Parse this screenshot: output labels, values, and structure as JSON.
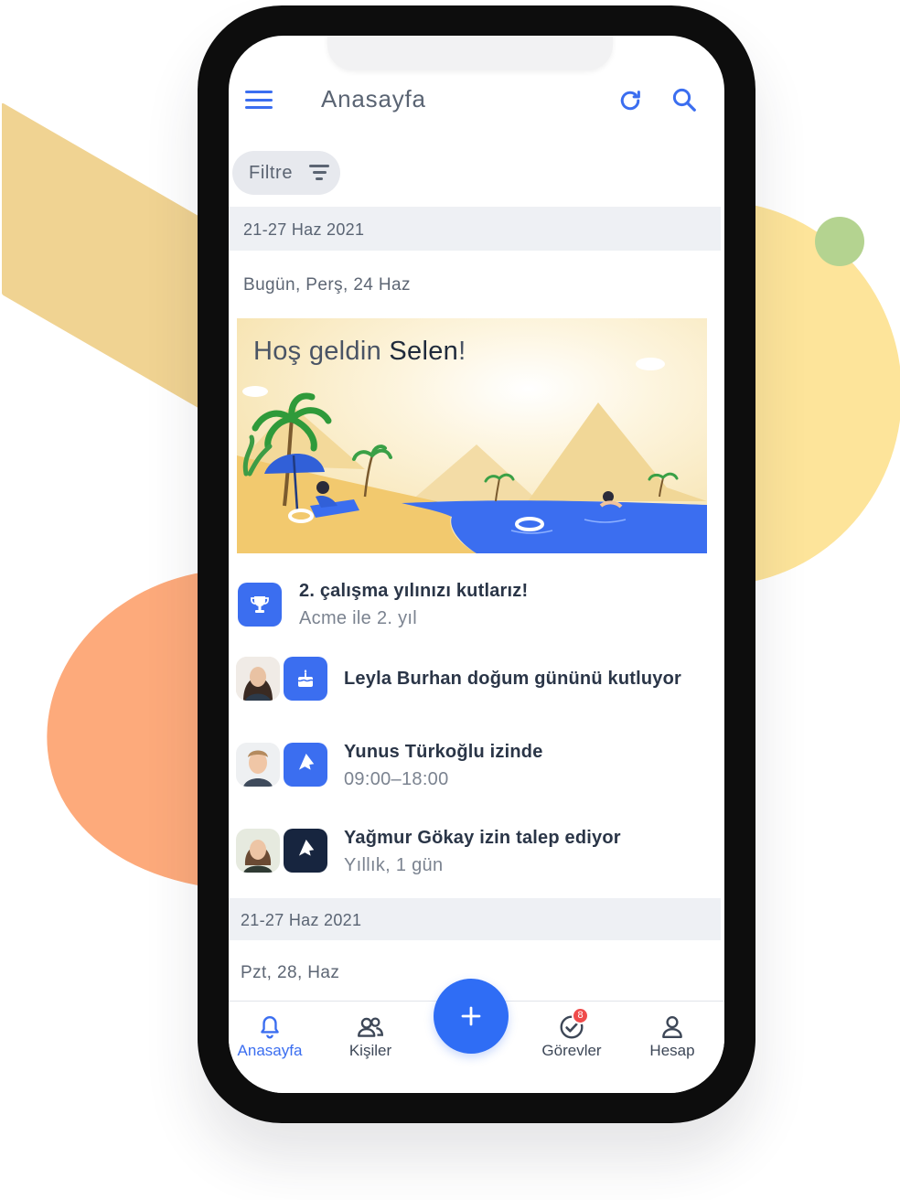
{
  "header": {
    "title": "Anasayfa"
  },
  "filter": {
    "label": "Filtre"
  },
  "feed": {
    "week_range": "21-27 Haz 2021",
    "day_label": "Bugün, Perş, 24 Haz",
    "welcome": {
      "greeting": "Hoş geldin",
      "name": "Selen",
      "punct": "!"
    },
    "anniversary": {
      "title": "2. çalışma yılınızı kutlarız!",
      "subtitle": "Acme ile 2. yıl"
    },
    "events": [
      {
        "title": "Leyla Burhan doğum gününü kutluyor",
        "subtitle": ""
      },
      {
        "title": "Yunus Türkoğlu izinde",
        "subtitle": "09:00–18:00"
      },
      {
        "title": "Yağmur Gökay izin talep ediyor",
        "subtitle": "Yıllık, 1 gün"
      }
    ],
    "week_range_2": "21-27 Haz 2021",
    "day_label_2": "Pzt, 28, Haz"
  },
  "bottom_nav": {
    "items": [
      {
        "label": "Anasayfa",
        "icon": "bell-icon",
        "active": true
      },
      {
        "label": "Kişiler",
        "icon": "people-icon"
      },
      {
        "label": "Görevler",
        "icon": "check-circle-icon",
        "badge": "8"
      },
      {
        "label": "Hesap",
        "icon": "person-icon"
      }
    ],
    "fab_icon": "plus-icon"
  },
  "colors": {
    "accent": "#3b6ef0",
    "dark_icon": "#17253f",
    "badge": "#ef4b4b",
    "deco_yellow": "#fde49a",
    "deco_orange": "#fdaa7b",
    "deco_sand": "#f0d392",
    "deco_green": "#b4d390"
  }
}
